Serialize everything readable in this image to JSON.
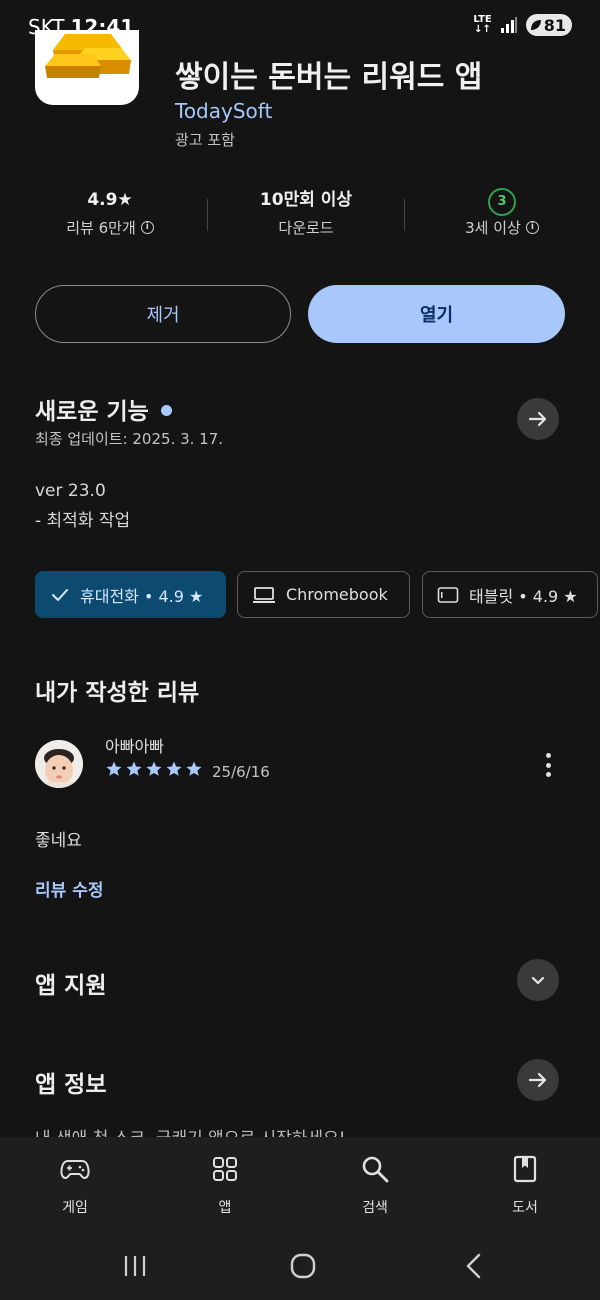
{
  "status_bar": {
    "carrier": "SKT",
    "time": "12:41",
    "network": "LTE",
    "battery": "81"
  },
  "app": {
    "title": "쌓이는 돈버는 리워드 앱",
    "developer": "TodaySoft",
    "ad_label": "광고 포함",
    "icon_name": "gold-bars-icon"
  },
  "stats": {
    "rating": "4.9★",
    "reviews_label": "리뷰 6만개",
    "downloads": "10만회 이상",
    "downloads_label": "다운로드",
    "age_badge": "3",
    "age_label": "3세 이상"
  },
  "actions": {
    "uninstall": "제거",
    "open": "열기"
  },
  "whats_new": {
    "title": "새로운 기능",
    "updated": "최종 업데이트: 2025. 3. 17.",
    "version": "ver 23.0",
    "note": "- 최적화 작업"
  },
  "devices": [
    {
      "label": "휴대전화 • 4.9 ★",
      "selected": true,
      "icon": "check-icon"
    },
    {
      "label": "Chromebook",
      "selected": false,
      "icon": "laptop-icon"
    },
    {
      "label": "태블릿 • 4.9 ★",
      "selected": false,
      "icon": "tablet-icon"
    }
  ],
  "my_review": {
    "title": "내가 작성한 리뷰",
    "reviewer": "아빠아빠",
    "stars": 5,
    "date": "25/6/16",
    "text": "좋네요",
    "edit_label": "리뷰 수정"
  },
  "app_support": {
    "title": "앱 지원"
  },
  "app_info": {
    "title": "앱 정보",
    "peek": "내 생애 첫 스크, 금캐기 앱으로 시작하세요!"
  },
  "bottom_nav": [
    {
      "label": "게임",
      "icon": "gamepad-icon"
    },
    {
      "label": "앱",
      "icon": "apps-grid-icon"
    },
    {
      "label": "검색",
      "icon": "search-icon"
    },
    {
      "label": "도서",
      "icon": "book-icon"
    }
  ],
  "colors": {
    "background": "#141414",
    "accent": "#a8c7fa",
    "selected_chip": "#0d4a6f",
    "age_badge_green": "#2fa24c"
  }
}
